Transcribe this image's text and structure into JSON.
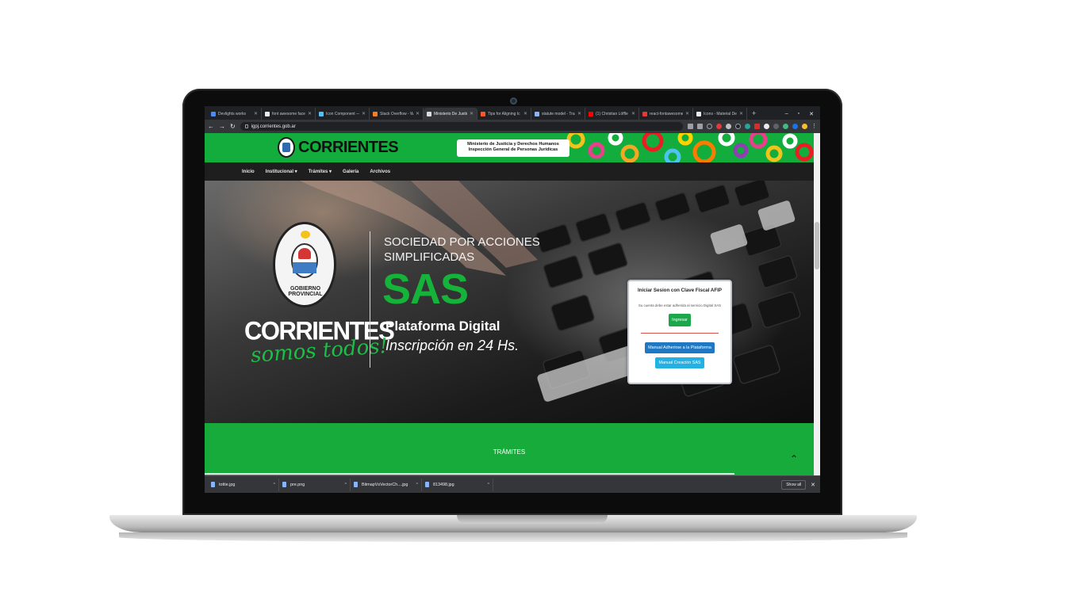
{
  "browser": {
    "tabs": [
      {
        "title": "Devlights works",
        "color": "#4b8bf5"
      },
      {
        "title": "font awesome facel",
        "color": "#e8eaed"
      },
      {
        "title": "Icon Component —",
        "color": "#4fc3f7"
      },
      {
        "title": "Stack Overflow - W",
        "color": "#f48024"
      },
      {
        "title": "Ministerio De Justic",
        "color": "#dadce0",
        "active": true
      },
      {
        "title": "Tips for Aligning Ic",
        "color": "#ff5722"
      },
      {
        "title": "statute model - Tra",
        "color": "#8ab4f8"
      },
      {
        "title": "(1) Christian Löffle",
        "color": "#ff0000"
      },
      {
        "title": "react-fontawesome",
        "color": "#e53935"
      },
      {
        "title": "Icons - Material De",
        "color": "#e8eaed"
      }
    ],
    "new_tab": "+",
    "window_controls": [
      "–",
      "▫",
      "✕"
    ],
    "url": "igpj.corrientes.gob.ar"
  },
  "site": {
    "brand": "CORRIENTES",
    "ministry_line1": "Ministerio de Justicia y Derechos Humanos",
    "ministry_line2": "Inspección General de Personas Jurídicas",
    "nav": [
      "Inicio",
      "Institucional ▾",
      "Trámites ▾",
      "Galería",
      "Archivos"
    ]
  },
  "hero": {
    "seal_text": "GOBIERNO PROVINCIAL",
    "corrientes": "CORRIENTES",
    "somos": "somos todos!",
    "line1": "SOCIEDAD POR ACCIONES",
    "line2": "SIMPLIFICADAS",
    "sas": "SAS",
    "plataforma": "Plataforma Digital",
    "inscripcion": "Inscripción en 24 Hs."
  },
  "login": {
    "title": "Iniciar Sesion con Clave Fiscal AFIP",
    "note": "Su cuenta debe estar adherida al servicio Digital SAS",
    "ingresar": "Ingresar",
    "manual_adherirse": "Manual Adherirse a la Plataforma",
    "manual_creacion": "Manual Creación SAS"
  },
  "tramites": {
    "title": "TRÁMITES",
    "to_top": "⌃"
  },
  "downloads": {
    "items": [
      {
        "name": "tottie.jpg"
      },
      {
        "name": "pre.png"
      },
      {
        "name": "BitmapVsVectorCh....jpg"
      },
      {
        "name": "813498.jpg"
      }
    ],
    "show_all": "Show all",
    "close": "✕"
  }
}
